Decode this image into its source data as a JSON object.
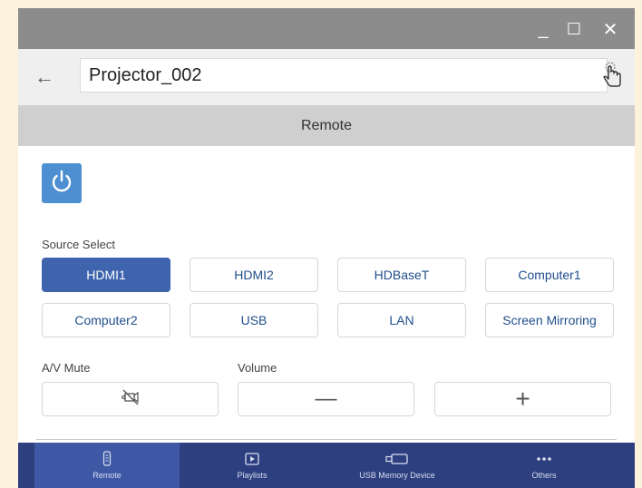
{
  "window": {
    "controls": [
      {
        "name": "minimize",
        "glyph": "_"
      },
      {
        "name": "maximize",
        "glyph": "☐"
      },
      {
        "name": "close",
        "glyph": "✕"
      }
    ]
  },
  "address": {
    "back_glyph": "←",
    "device_name": "Projector_002",
    "touch_icon": "hand-pointer-icon"
  },
  "header": {
    "title": "Remote"
  },
  "power": {
    "icon": "power-icon",
    "color": "#4d8fd0"
  },
  "source": {
    "label": "Source Select",
    "buttons": [
      {
        "label": "HDMI1",
        "active": true
      },
      {
        "label": "HDMI2",
        "active": false
      },
      {
        "label": "HDBaseT",
        "active": false
      },
      {
        "label": "Computer1",
        "active": false
      },
      {
        "label": "Computer2",
        "active": false
      },
      {
        "label": "USB",
        "active": false
      },
      {
        "label": "LAN",
        "active": false
      },
      {
        "label": "Screen Mirroring",
        "active": false
      }
    ]
  },
  "controls": {
    "av_mute_label": "A/V Mute",
    "volume_label": "Volume",
    "av_mute_icon": "av-mute-icon",
    "volume_down_glyph": "—",
    "volume_up_glyph": "+"
  },
  "nav": {
    "items": [
      {
        "label": "Remote",
        "icon": "remote-icon",
        "active": true
      },
      {
        "label": "Playlists",
        "icon": "playlist-icon",
        "active": false
      },
      {
        "label": "USB Memory Device",
        "icon": "usb-icon",
        "active": false
      },
      {
        "label": "Others",
        "icon": "more-icon",
        "active": false
      }
    ]
  },
  "colors": {
    "accent": "#3d64ad",
    "nav_bg": "#2d3f7f",
    "nav_active": "#3f58a5",
    "titlebar": "#8c8c8c"
  }
}
